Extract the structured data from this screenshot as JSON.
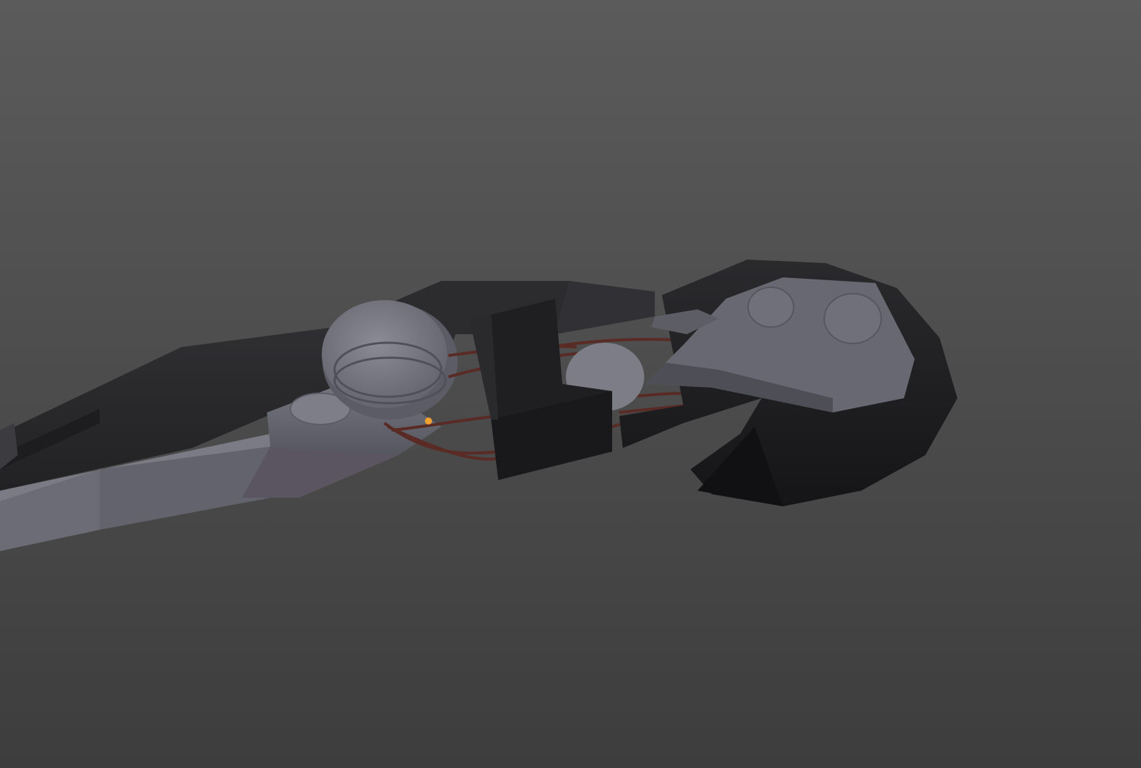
{
  "viewport": {
    "background_top": "#5b5b5b",
    "background_bottom": "#3d3d3d"
  },
  "model": {
    "light_gray": "#6d6e77",
    "mid_gray": "#5a5b63",
    "dark_shell": "#2b2b2e",
    "darker_shell": "#1f1f22",
    "black_part": "#18181a",
    "cable_color": "#5a2a24",
    "selection_dot": "#f0a030"
  }
}
